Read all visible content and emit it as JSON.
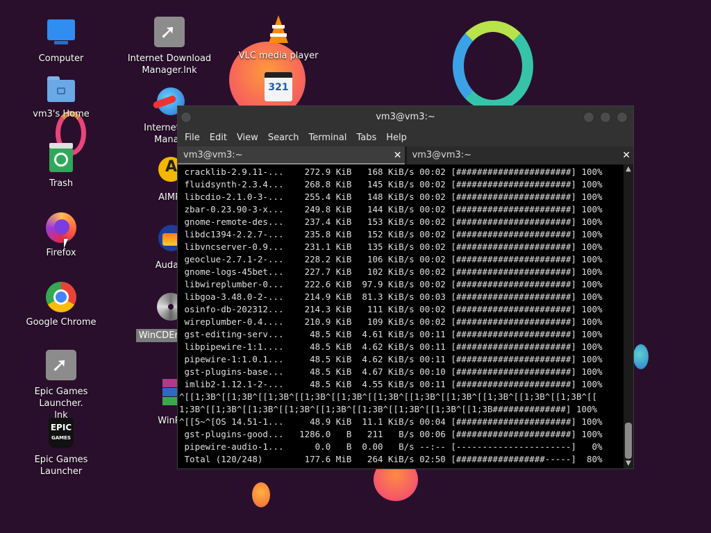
{
  "colors": {
    "desktop_bg": "#2a0f2d",
    "terminal_bg": "#000000",
    "titlebar": "#323232"
  },
  "desktop_icons": [
    {
      "label": "Computer",
      "icon": "monitor-icon"
    },
    {
      "label": "vm3's Home",
      "icon": "home-folder-icon"
    },
    {
      "label": "Trash",
      "icon": "trash-icon"
    },
    {
      "label": "Firefox",
      "icon": "firefox-icon"
    },
    {
      "label": "Google Chrome",
      "icon": "chrome-icon"
    },
    {
      "label": "Epic Games Launcher.\nlnk",
      "icon": "shortcut-icon"
    },
    {
      "label": "Epic Games Launcher",
      "icon": "epic-games-icon"
    },
    {
      "label": "Internet Download\nManager.lnk",
      "icon": "shortcut-icon"
    },
    {
      "label": "Internet Do\nManag",
      "icon": "idm-globe-icon"
    },
    {
      "label": "AIMP",
      "icon": "aimp-icon"
    },
    {
      "label": "Audac",
      "icon": "audacity-icon"
    },
    {
      "label": "WinCDEmu",
      "icon": "disc-icon"
    },
    {
      "label": "WinR",
      "icon": "winrar-icon"
    },
    {
      "label": "VLC media player",
      "icon": "vlc-cone-icon"
    },
    {
      "label": "321",
      "icon": "mpc-321-icon"
    }
  ],
  "terminal": {
    "title": "vm3@vm3:~",
    "menu": [
      "File",
      "Edit",
      "View",
      "Search",
      "Terminal",
      "Tabs",
      "Help"
    ],
    "tabs": [
      {
        "label": "vm3@vm3:~",
        "close": "✕"
      },
      {
        "label": "vm3@vm3:~",
        "close": "✕"
      }
    ],
    "output": " cracklib-2.9.11-...    272.9 KiB   168 KiB/s 00:02 [######################] 100%\n fluidsynth-2.3.4...    268.8 KiB   145 KiB/s 00:02 [######################] 100%\n libcdio-2.1.0-3-...    255.4 KiB   148 KiB/s 00:02 [######################] 100%\n zbar-0.23.90-3-x...    249.8 KiB   144 KiB/s 00:02 [######################] 100%\n gnome-remote-des...    237.4 KiB   153 KiB/s 00:02 [######################] 100%\n libdc1394-2.2.7-...    235.8 KiB   152 KiB/s 00:02 [######################] 100%\n libvncserver-0.9...    231.1 KiB   135 KiB/s 00:02 [######################] 100%\n geoclue-2.7.1-2-...    228.2 KiB   106 KiB/s 00:02 [######################] 100%\n gnome-logs-45bet...    227.7 KiB   102 KiB/s 00:02 [######################] 100%\n libwireplumber-0...    222.6 KiB  97.9 KiB/s 00:02 [######################] 100%\n libgoa-3.48.0-2-...    214.9 KiB  81.3 KiB/s 00:03 [######################] 100%\n osinfo-db-202312...    214.3 KiB   111 KiB/s 00:02 [######################] 100%\n wireplumber-0.4....    210.9 KiB   109 KiB/s 00:02 [######################] 100%\n gst-editing-serv...     48.5 KiB  4.61 KiB/s 00:11 [######################] 100%\n libpipewire-1:1....     48.5 KiB  4.62 KiB/s 00:11 [######################] 100%\n pipewire-1:1.0.1...     48.5 KiB  4.62 KiB/s 00:11 [######################] 100%\n gst-plugins-base...     48.5 KiB  4.67 KiB/s 00:10 [######################] 100%\n imlib2-1.12.1-2-...     48.5 KiB  4.55 KiB/s 00:11 [######################] 100%\n^[[1;3B^[[1;3B^[[1;3B^[[1;3B^[[1;3B^[[1;3B^[[1;3B^[[1;3B^[[1;3B^[[1;3B^[[1;3B^[[\n1;3B^[[1;3B^[[1;3B^[[1;3B^[[1;3B^[[1;3B^[[1;3B^[[1;3B^[[1;3B##############] 100%\n^[[5~^[OS 14.51-1...     48.9 KiB  11.1 KiB/s 00:04 [######################] 100%\n gst-plugins-good...   1286.0   B   211   B/s 00:06 [######################] 100%\n pipewire-audio-1...      0.0   B  0.00   B/s --:-- [----------------------]   0%\n Total (120/248)        177.6 MiB   264 KiB/s 02:50 [#################-----]  80%",
    "scroll_up": "▲",
    "scroll_down": "▼"
  }
}
